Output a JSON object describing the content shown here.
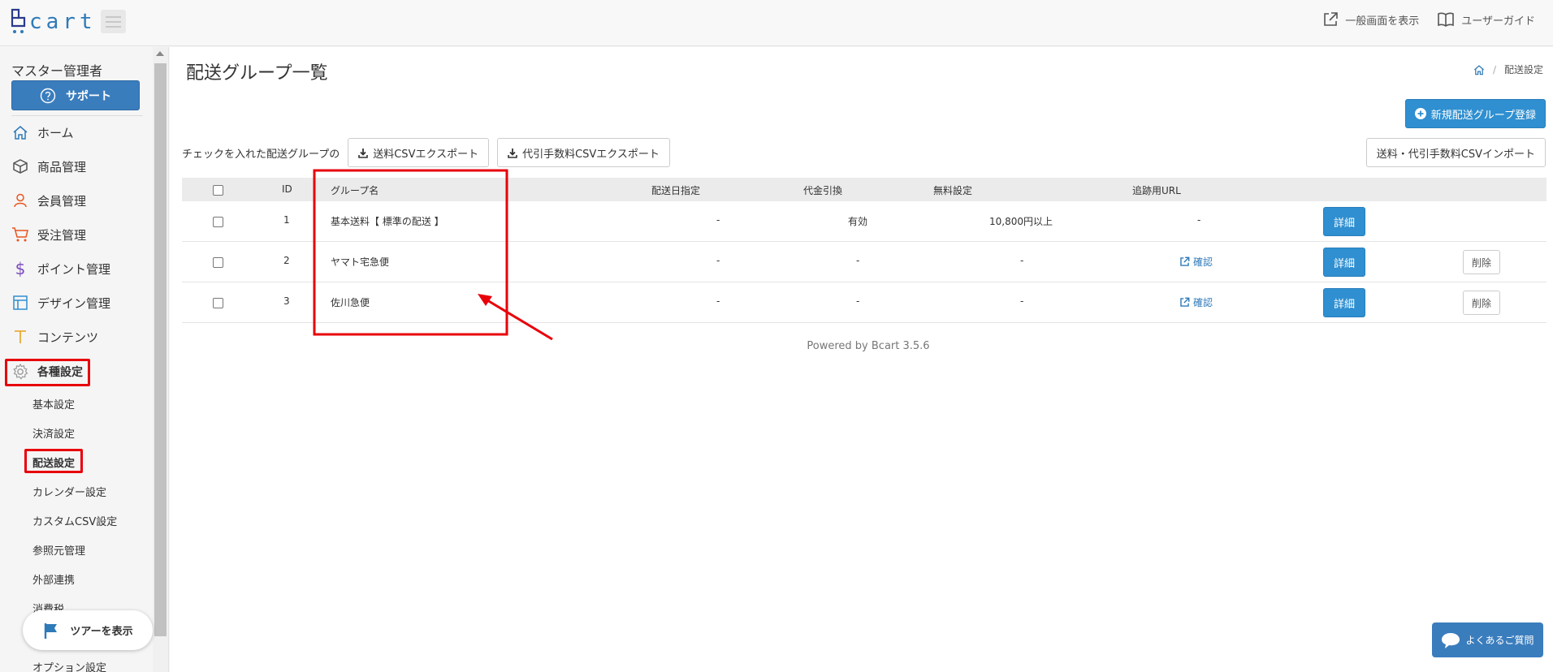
{
  "header": {
    "logo_text": "cart",
    "links": [
      {
        "label": "一般画面を表示",
        "icon": "external-link-icon"
      },
      {
        "label": "ユーザーガイド",
        "icon": "book-icon"
      }
    ]
  },
  "sidebar": {
    "role": "マスター管理者",
    "support_label": "サポート",
    "items": [
      {
        "label": "ホーム",
        "icon": "home-icon",
        "color": "#2f7ab9"
      },
      {
        "label": "商品管理",
        "icon": "cube-icon",
        "color": "#555555"
      },
      {
        "label": "会員管理",
        "icon": "user-icon",
        "color": "#e8551e"
      },
      {
        "label": "受注管理",
        "icon": "cart-icon",
        "color": "#e8551e"
      },
      {
        "label": "ポイント管理",
        "icon": "dollar-icon",
        "color": "#7b4bbf"
      },
      {
        "label": "デザイン管理",
        "icon": "layout-icon",
        "color": "#2f8fd0"
      },
      {
        "label": "コンテンツ",
        "icon": "text-icon",
        "color": "#e8a21e"
      },
      {
        "label": "各種設定",
        "icon": "gear-icon",
        "color": "#888888"
      }
    ],
    "sub_items": [
      "基本設定",
      "決済設定",
      "配送設定",
      "カレンダー設定",
      "カスタムCSV設定",
      "参照元管理",
      "外部連携",
      "消費税",
      "オプション設定"
    ],
    "tour_label": "ツアーを表示"
  },
  "main": {
    "title": "配送グループ一覧",
    "breadcrumb": "配送設定",
    "new_button": "新規配送グループ登録",
    "export_caption": "チェックを入れた配送グループの",
    "export_buttons": [
      "送料CSVエクスポート",
      "代引手数料CSVエクスポート"
    ],
    "import_button": "送料・代引手数料CSVインポート",
    "columns": [
      "ID",
      "グループ名",
      "配送日指定",
      "代金引換",
      "無料設定",
      "追跡用URL"
    ],
    "rows": [
      {
        "id": "1",
        "name": "基本送料【 標準の配送 】",
        "date_spec": "-",
        "cod": "有効",
        "free": "10,800円以上",
        "url": "-",
        "detail": "詳細",
        "delete": ""
      },
      {
        "id": "2",
        "name": "ヤマト宅急便",
        "date_spec": "-",
        "cod": "-",
        "free": "-",
        "url": "確認",
        "detail": "詳細",
        "delete": "削除"
      },
      {
        "id": "3",
        "name": "佐川急便",
        "date_spec": "-",
        "cod": "-",
        "free": "-",
        "url": "確認",
        "detail": "詳細",
        "delete": "削除"
      }
    ],
    "powered": "Powered by Bcart 3.5.6"
  },
  "faq_label": "よくあるご質問",
  "colors": {
    "primary": "#2f8fd0",
    "support": "#3a7dbd",
    "highlight": "#e8000b"
  }
}
